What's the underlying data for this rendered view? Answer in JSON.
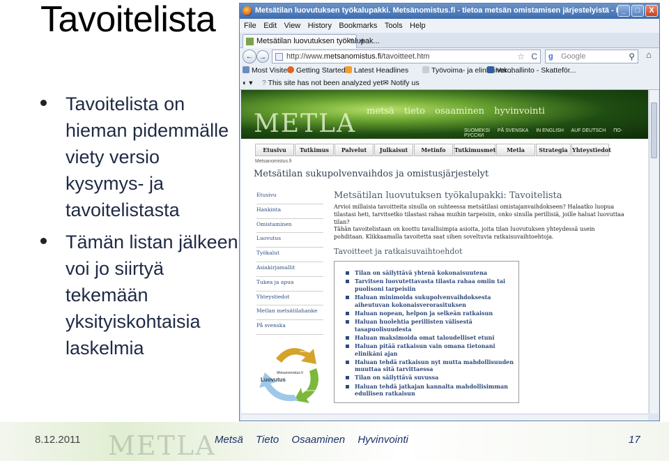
{
  "slide": {
    "title": "Tavoitelista",
    "bullets": [
      "Tavoitelista on hieman pidemmälle viety versio kysymys- ja tavoitelistasta",
      "Tämän listan jälkeen voi jo siirtyä tekemään yksityiskohtaisia laskelmia"
    ],
    "footer": {
      "date": "8.12.2011",
      "logo_text": "METLA",
      "words": [
        "Metsä",
        "Tieto",
        "Osaaminen",
        "Hyvinvointi"
      ],
      "page_number": "17"
    }
  },
  "browser": {
    "window_title": "Metsätilan luovutuksen työkalupakki. Metsänomistus.fi - tietoa metsän omistamisen järjestelyistä - M...",
    "window_buttons": [
      "_",
      "□",
      "X"
    ],
    "menu": [
      "File",
      "Edit",
      "View",
      "History",
      "Bookmarks",
      "Tools",
      "Help"
    ],
    "tab_label": "Metsätilan luovutuksen työkalupak...",
    "tab_close": "×",
    "new_tab": "+",
    "nav": {
      "back": "←",
      "forward": "→",
      "reload": "C",
      "home": "⌂"
    },
    "url_prefix": "http://www.",
    "url_domain": "metsanomistus.fi",
    "url_suffix": "/tavoitteet.htm",
    "search_engine": "g",
    "search_placeholder": "Google",
    "bookmarks": [
      "Most Visited",
      "Getting Started",
      "Latest Headlines",
      "Työvoima- ja elinkeinok...",
      "Verohallinto - Skatteför..."
    ],
    "notify": [
      "This site has not been analyzed yet",
      "Notify us"
    ]
  },
  "page": {
    "banner_logo": "METLA",
    "banner_words": [
      "metsä",
      "tieto",
      "osaaminen",
      "hyvinvointi"
    ],
    "languages": [
      "SUOMEKSI",
      "PÅ SVENSKA",
      "IN ENGLISH",
      "AUF DEUTSCH",
      "ПО-РУССКИ"
    ],
    "main_nav": [
      "Etusivu",
      "Tutkimus",
      "Palvelut",
      "Julkaisut",
      "Metinfo",
      "Tutkimusmetsät",
      "Metla",
      "Strategia",
      "Yhteystiedot"
    ],
    "domain": "Metsanomistus.fi",
    "site_title": "Metsätilan sukupolvenvaihdos ja omistusjärjestelyt",
    "side_nav": [
      "Etusivu",
      "Hankinta",
      "Omistaminen",
      "Luovutus",
      "Työkalut",
      "Asiakirjamallit",
      "Tukea ja apua",
      "Yhteystiedot",
      "Metlan metsätilahanke",
      "På svenska"
    ],
    "logo_labels": {
      "center": "Metsanomistus.fi",
      "main": "Luovutus",
      "top": "Hankinta",
      "right": "Omistaminen"
    },
    "content_title": "Metsätilan luovutuksen työkalupakki: Tavoitelista",
    "intro": "Arvioi millaisia tavoitteita sinulla on suhteessa metsätilasi omistajanvaihdokseen? Halaatko luopua tilastasi heti, tarvitsetko tilastasi rahaa muihin tarpeisiin, onko sinulla perillisiä, joille haluat luovuttaa tilan?",
    "intro2": "Tähän tavoitelistaan on koottu tavallisimpia asioita, joita tilan luovutuksen yhteydessä usein pohditaan. Klikkaamalla tavoitetta saat sihen soveltuvia ratkaisuvaihtoehtoja.",
    "section_title": "Tavoitteet ja ratkaisuvaihtoehdot",
    "options": [
      "Tilan on säilyttävä yhtenä kokonaisuutena",
      "Tarvitsen luovutettavasta tilasta rahaa omiin tai puolisoni tarpeisiin",
      "Haluan minimoida sukupolvenvaihdoksesta aiheutuvan kokonaisverorasituksen",
      "Haluan nopean, helpon ja selkeän ratkaisun",
      "Haluan huolehtia perillisten välisestä tasapuolisuudesta",
      "Haluan maksimoida omat taloudelliset etuni",
      "Haluan pitää ratkaisun vain omana tietonani elinikäni ajan",
      "Haluan tehdä ratkaisun nyt mutta mahdollisuuden muuttaa sitä tarvittaessa",
      "Tilan on säilyttävä suvussa",
      "Haluan tehdä jatkajan kannalta mahdollisimman edullisen ratkaisun"
    ]
  },
  "colors": {
    "window_title_bg": "#3d6db1",
    "link_blue": "#2f4a7a",
    "footer_text": "#1c2f6b"
  }
}
